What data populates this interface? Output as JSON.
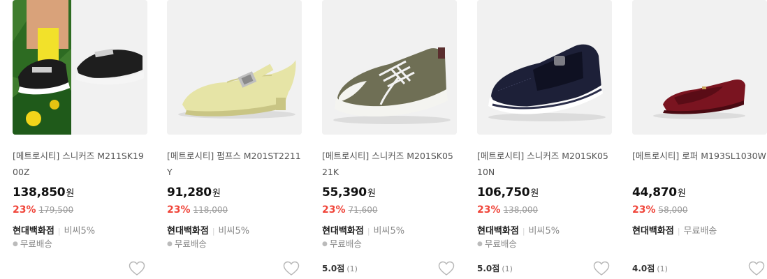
{
  "products": [
    {
      "title": "[메트로시티] 스니커즈 M211SK1900Z",
      "price": "138,850",
      "currency": "원",
      "discount": "23%",
      "original_price": "179,500",
      "store": "현대백화점",
      "benefit": "비씨5%",
      "shipping": "무료배송",
      "rating": "",
      "review_count": ""
    },
    {
      "title": "[메트로시티] 펌프스 M201ST2211Y",
      "price": "91,280",
      "currency": "원",
      "discount": "23%",
      "original_price": "118,000",
      "store": "현대백화점",
      "benefit": "비씨5%",
      "shipping": "무료배송",
      "rating": "",
      "review_count": ""
    },
    {
      "title": "[메트로시티] 스니커즈 M201SK0521K",
      "price": "55,390",
      "currency": "원",
      "discount": "23%",
      "original_price": "71,600",
      "store": "현대백화점",
      "benefit": "비씨5%",
      "shipping": "무료배송",
      "rating": "5.0점",
      "review_count": "(1)"
    },
    {
      "title": "[메트로시티] 스니커즈 M201SK0510N",
      "price": "106,750",
      "currency": "원",
      "discount": "23%",
      "original_price": "138,000",
      "store": "현대백화점",
      "benefit": "비씨5%",
      "shipping": "무료배송",
      "rating": "5.0점",
      "review_count": "(1)"
    },
    {
      "title": "[메트로시티] 로퍼 M193SL1030W",
      "price": "44,870",
      "currency": "원",
      "discount": "23%",
      "original_price": "58,000",
      "store": "현대백화점",
      "benefit": "무료배송",
      "shipping": "",
      "rating": "4.0점",
      "review_count": "(1)"
    }
  ],
  "colors": {
    "discount": "#f0453a",
    "thumb_bg": "#f1f1f1",
    "muted_text": "#888888"
  },
  "icons": {
    "wishlist": "heart-outline-icon"
  }
}
